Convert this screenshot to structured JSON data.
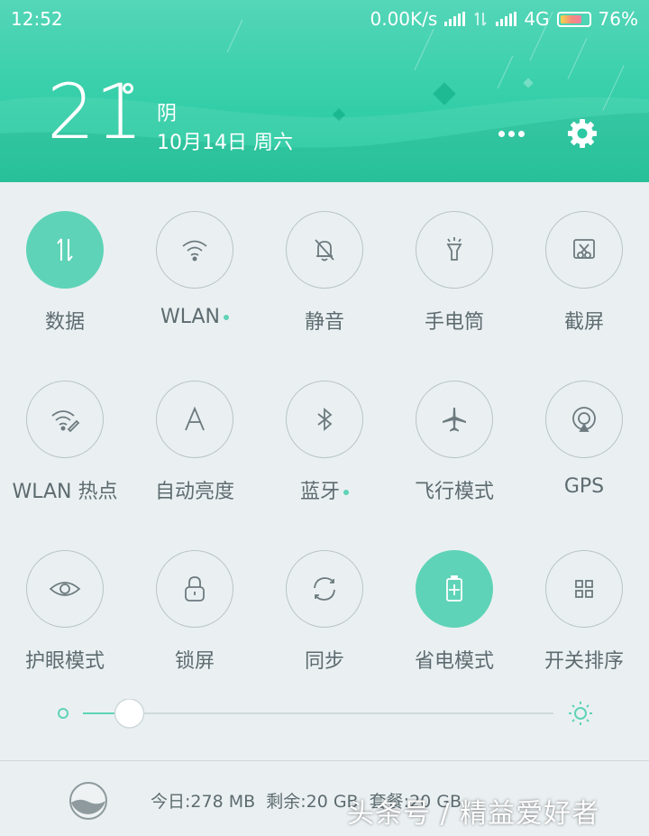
{
  "status_bar": {
    "time": "12:52",
    "network_speed": "0.00K/s",
    "network_type": "4G",
    "battery": "76%",
    "battery_level": 0.76
  },
  "weather": {
    "temperature": "21",
    "condition": "阴",
    "date": "10月14日 周六"
  },
  "toggles": [
    {
      "label": "数据",
      "icon": "data-arrows-icon",
      "on": true
    },
    {
      "label": "WLAN",
      "icon": "wifi-icon",
      "on": false,
      "dot": true
    },
    {
      "label": "静音",
      "icon": "bell-off-icon",
      "on": false
    },
    {
      "label": "手电筒",
      "icon": "flashlight-icon",
      "on": false
    },
    {
      "label": "截屏",
      "icon": "scissors-screenshot-icon",
      "on": false
    },
    {
      "label": "WLAN 热点",
      "icon": "wifi-hotspot-icon",
      "on": false
    },
    {
      "label": "自动亮度",
      "icon": "auto-brightness-icon",
      "on": false
    },
    {
      "label": "蓝牙",
      "icon": "bluetooth-icon",
      "on": false,
      "dot": true
    },
    {
      "label": "飞行模式",
      "icon": "airplane-icon",
      "on": false
    },
    {
      "label": "GPS",
      "icon": "gps-icon",
      "on": false
    },
    {
      "label": "护眼模式",
      "icon": "eye-icon",
      "on": false
    },
    {
      "label": "锁屏",
      "icon": "lock-icon",
      "on": false
    },
    {
      "label": "同步",
      "icon": "sync-icon",
      "on": false
    },
    {
      "label": "省电模式",
      "icon": "battery-saver-icon",
      "on": true
    },
    {
      "label": "开关排序",
      "icon": "grid-sort-icon",
      "on": false
    }
  ],
  "brightness": {
    "level": 0.07
  },
  "data_usage": {
    "text": "今日:278 MB  剩余:20 GB  套餐:20 GB"
  },
  "watermark": "头条号 / 精益爱好者",
  "colors": {
    "accent": "#5fd3b7",
    "header_top": "#54d6b8",
    "header_bottom": "#1fc69b",
    "label": "#5d6b70",
    "outline": "#b8c3c6"
  }
}
